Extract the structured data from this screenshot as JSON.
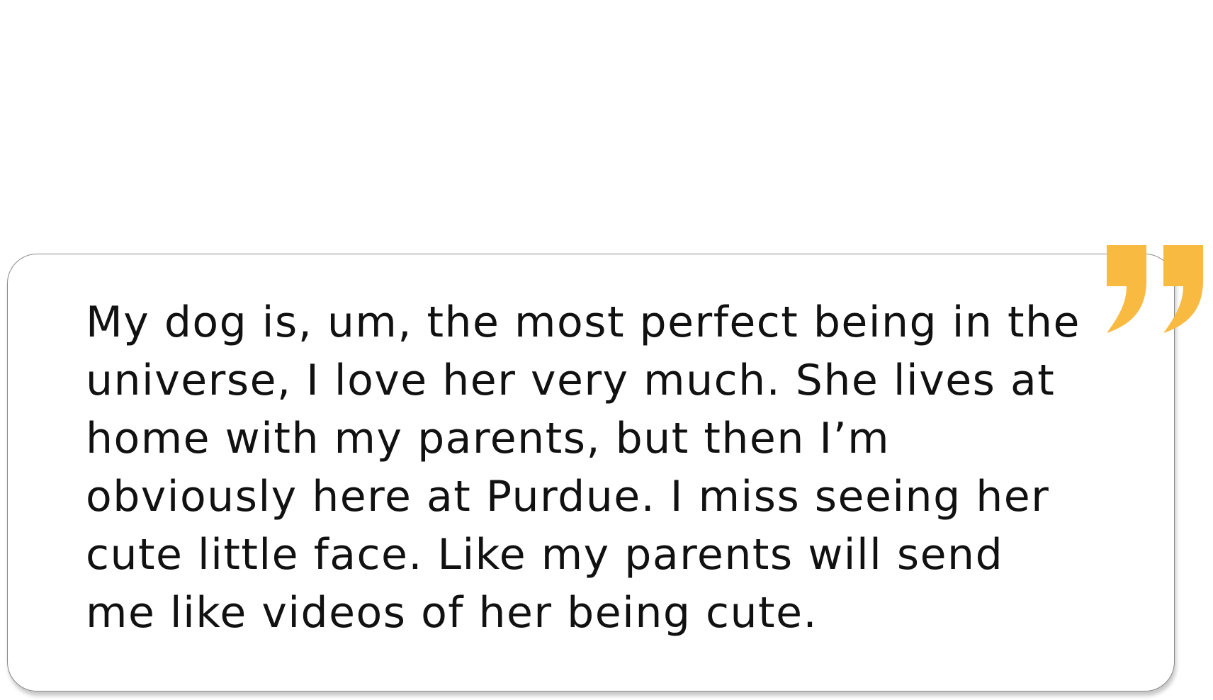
{
  "quote": {
    "text": "My dog is, um, the most perfect being in the\nuniverse, I love her very much. She lives at\nhome with my parents, but then I’m\nobviously here at Purdue. I miss seeing her\ncute little face. Like my parents will send\nme like videos of her being cute."
  },
  "icons": {
    "quote_mark": "closing-quote-icon"
  },
  "colors": {
    "accent": "#F9BA42",
    "text": "#111111",
    "card_border": "#8A8A8A",
    "background": "#FFFFFF"
  }
}
